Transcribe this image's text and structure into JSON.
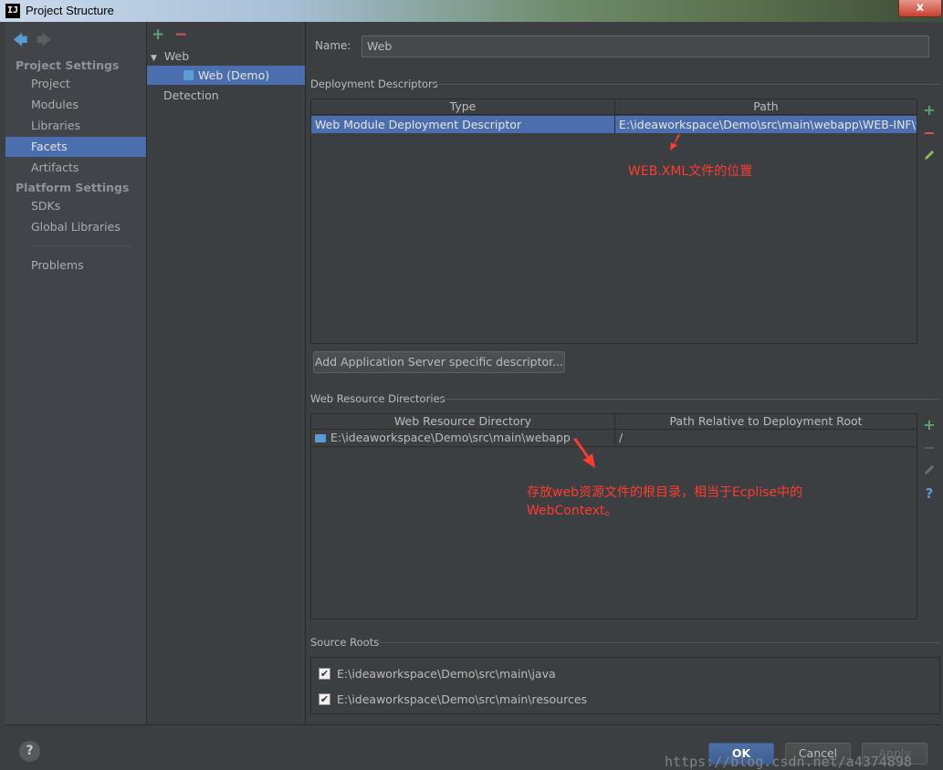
{
  "window": {
    "title": "Project Structure",
    "icon": "IJ",
    "close_label": "x"
  },
  "nav": {
    "back": "🡄",
    "forward": "🡆",
    "project_settings": "Project Settings",
    "items_project": [
      "Project",
      "Modules",
      "Libraries",
      "Facets",
      "Artifacts"
    ],
    "platform_settings": "Platform Settings",
    "items_platform": [
      "SDKs",
      "Global Libraries"
    ],
    "problems": "Problems",
    "selected": "Facets"
  },
  "tree": {
    "add": "+",
    "remove": "−",
    "web": "Web",
    "web_demo": "Web (Demo)",
    "detection": "Detection"
  },
  "form": {
    "name_label": "Name:",
    "name_value": "Web",
    "deployment_title": "Deployment Descriptors",
    "dd_columns": [
      "Type",
      "Path"
    ],
    "dd_row": {
      "type": "Web Module Deployment Descriptor",
      "path": "E:\\ideaworkspace\\Demo\\src\\main\\webapp\\WEB-INF\\we"
    },
    "add_server_button": "Add Application Server specific descriptor...",
    "web_res_title": "Web Resource Directories",
    "wr_columns": [
      "Web Resource Directory",
      "Path Relative to Deployment Root"
    ],
    "wr_row": {
      "dir": "E:\\ideaworkspace\\Demo\\src\\main\\webapp",
      "rel": "/"
    },
    "source_roots_title": "Source Roots",
    "source_roots": [
      {
        "path": "E:\\ideaworkspace\\Demo\\src\\main\\java",
        "checked": true
      },
      {
        "path": "E:\\ideaworkspace\\Demo\\src\\main\\resources",
        "checked": true
      }
    ]
  },
  "annotations": {
    "webxml": "WEB.XML文件的位置",
    "webroot_line1": "存放web资源文件的根目录，相当于Ecplise中的",
    "webroot_line2": "WebContext。"
  },
  "buttons": {
    "ok": "OK",
    "cancel": "Cancel",
    "apply": "Apply",
    "help": "?"
  },
  "watermark": "https://blog.csdn.net/a4374898",
  "colors": {
    "selection": "#4b6eaf",
    "add": "#59a869",
    "remove": "#e05555",
    "annotation": "#ff3b30"
  }
}
